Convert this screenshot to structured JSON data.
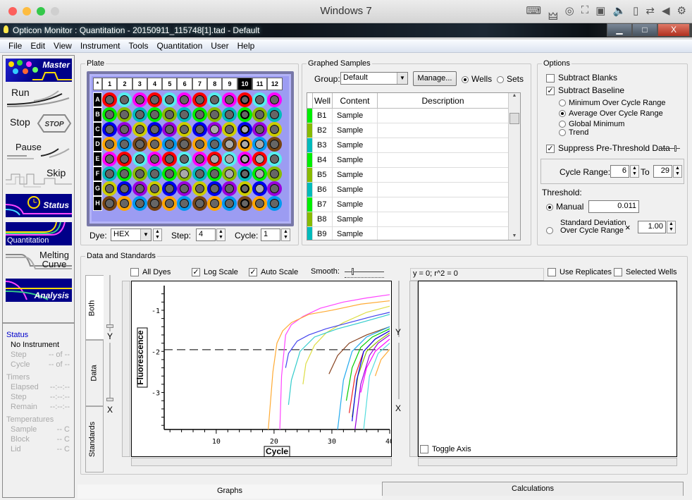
{
  "mac": {
    "title": "Windows 7",
    "traffic_colors": [
      "#fc605c",
      "#fdbc40",
      "#34c84a",
      "#cfcfcf"
    ],
    "status_icons": [
      "keyboard-icon",
      "usb-icon",
      "cd-icon",
      "network-icon",
      "floppy-icon",
      "audio-icon",
      "hdd-icon",
      "shared-folder-icon",
      "arrow-left-icon",
      "gear-icon"
    ],
    "status_glyphs": [
      "⌨",
      "🜲",
      "◎",
      "⛶",
      "▣",
      "🔈",
      "▯",
      "⇄",
      "◀",
      "⚙"
    ]
  },
  "window": {
    "title": "Opticon Monitor : Quantitation - 20150911_115748[1].tad - Default",
    "min": "▁",
    "max": "□",
    "close": "X"
  },
  "menu": [
    "File",
    "Edit",
    "View",
    "Instrument",
    "Tools",
    "Quantitation",
    "User",
    "Help"
  ],
  "nav": [
    {
      "label": "Master",
      "style": "dark"
    },
    {
      "label": "Run",
      "style": "light"
    },
    {
      "label": "Stop",
      "style": "light",
      "badge": "STOP"
    },
    {
      "label": "Pause",
      "style": "light"
    },
    {
      "label": "Skip",
      "style": "light"
    },
    {
      "label": "Status",
      "style": "dark"
    },
    {
      "label": "Quantitation",
      "style": "dark"
    },
    {
      "label": "Melting Curve",
      "style": "light"
    },
    {
      "label": "Analysis",
      "style": "dark"
    }
  ],
  "status": {
    "heading": "Status",
    "instrument": "No Instrument",
    "rows": [
      {
        "label": "Step",
        "value": "-- of --"
      },
      {
        "label": "Cycle",
        "value": "-- of --"
      }
    ],
    "timers_heading": "Timers",
    "timers": [
      {
        "label": "Elapsed",
        "value": "--:--:--"
      },
      {
        "label": "Step",
        "value": "--:--:--"
      },
      {
        "label": "Remain",
        "value": "--:--:--"
      }
    ],
    "temps_heading": "Temperatures",
    "temps": [
      {
        "label": "Sample",
        "value": "-- C"
      },
      {
        "label": "Block",
        "value": "-- C"
      },
      {
        "label": "Lid",
        "value": "-- C"
      }
    ]
  },
  "plate": {
    "label": "Plate",
    "corner": "*",
    "columns": [
      "1",
      "2",
      "3",
      "4",
      "5",
      "6",
      "7",
      "8",
      "9",
      "10",
      "11",
      "12"
    ],
    "selected_column": "10",
    "rows": [
      "A",
      "B",
      "C",
      "D",
      "E",
      "F",
      "G",
      "H"
    ],
    "ring_colors": {
      "A": [
        "#ff0000",
        "#55eeee",
        "#ff00ff",
        "#ff0000",
        "#55eeee",
        "#ff00ff",
        "#ff0000",
        "#55eeee",
        "#ff00ff",
        "#ff0000",
        "#55eeee",
        "#ff00ff"
      ],
      "B": [
        "#00ee00",
        "#88bb00",
        "#00bbbb",
        "#00ee00",
        "#88bb00",
        "#00bbbb",
        "#00ee00",
        "#88bb00",
        "#00bbbb",
        "#00ee00",
        "#88bb00",
        "#00bbbb"
      ],
      "C": [
        "#0000ee",
        "#9900dd",
        "#cccc00",
        "#0000ee",
        "#9900dd",
        "#cccc00",
        "#0000ee",
        "#9900dd",
        "#cccc00",
        "#0000ee",
        "#9900dd",
        "#cccc00"
      ],
      "D": [
        "#ffa500",
        "#0099ee",
        "#774411",
        "#ffa500",
        "#0099ee",
        "#774411",
        "#ffa500",
        "#0099ee",
        "#774411",
        "#ffa500",
        "#0099ee",
        "#774411"
      ],
      "E": [
        "#ff00ff",
        "#ff0000",
        "#55eeee",
        "#ff00ff",
        "#ff0000",
        "#55eeee",
        "#ff00ff",
        "#ff0000",
        "#55eeee",
        "#ff00ff",
        "#ff0000",
        "#55eeee"
      ],
      "F": [
        "#00bbbb",
        "#00ee00",
        "#88bb00",
        "#00bbbb",
        "#00ee00",
        "#88bb00",
        "#00bbbb",
        "#00ee00",
        "#88bb00",
        "#00bbbb",
        "#00ee00",
        "#88bb00"
      ],
      "G": [
        "#cccc00",
        "#0000ee",
        "#9900dd",
        "#cccc00",
        "#0000ee",
        "#9900dd",
        "#cccc00",
        "#0000ee",
        "#9900dd",
        "#cccc00",
        "#0000ee",
        "#9900dd"
      ],
      "H": [
        "#774411",
        "#ffa500",
        "#0099ee",
        "#774411",
        "#ffa500",
        "#0099ee",
        "#774411",
        "#ffa500",
        "#0099ee",
        "#774411",
        "#ffa500",
        "#0099ee"
      ]
    },
    "light_wells": [
      "C8",
      "C10",
      "D9",
      "D10",
      "D11",
      "E8",
      "E9",
      "E10",
      "E11",
      "F6",
      "F9",
      "F11",
      "G11"
    ],
    "dye_label": "Dye:",
    "dye_value": "HEX",
    "step_label": "Step:",
    "step_value": "4",
    "cycle_label": "Cycle:",
    "cycle_value": "1"
  },
  "graphed": {
    "label": "Graphed Samples",
    "group_label": "Group:",
    "group_value": "Default",
    "manage": "Manage...",
    "wells_radio": "Wells",
    "sets_radio": "Sets",
    "columns": [
      "Well",
      "Content",
      "Description"
    ],
    "rows": [
      {
        "well": "B1",
        "content": "Sample",
        "description": "",
        "color": "#00ee00"
      },
      {
        "well": "B2",
        "content": "Sample",
        "description": "",
        "color": "#88bb00"
      },
      {
        "well": "B3",
        "content": "Sample",
        "description": "",
        "color": "#00bbbb"
      },
      {
        "well": "B4",
        "content": "Sample",
        "description": "",
        "color": "#00ee00"
      },
      {
        "well": "B5",
        "content": "Sample",
        "description": "",
        "color": "#88bb00"
      },
      {
        "well": "B6",
        "content": "Sample",
        "description": "",
        "color": "#00bbbb"
      },
      {
        "well": "B7",
        "content": "Sample",
        "description": "",
        "color": "#00ee00"
      },
      {
        "well": "B8",
        "content": "Sample",
        "description": "",
        "color": "#88bb00"
      },
      {
        "well": "B9",
        "content": "Sample",
        "description": "",
        "color": "#00bbbb"
      }
    ]
  },
  "options": {
    "label": "Options",
    "subtract_blanks": "Subtract Blanks",
    "subtract_blanks_checked": false,
    "subtract_baseline": "Subtract Baseline",
    "subtract_baseline_checked": true,
    "baseline_modes": [
      {
        "label": "Minimum Over Cycle Range",
        "selected": false
      },
      {
        "label": "Average Over Cycle Range",
        "selected": true
      },
      {
        "label": "Global Minimum",
        "selected": false
      },
      {
        "label": "Trend",
        "selected": false
      }
    ],
    "suppress": "Suppress Pre-Threshold Data",
    "suppress_checked": true,
    "cycle_range_label": "Cycle Range:",
    "cycle_from": "6",
    "to_label": "To",
    "cycle_to": "29",
    "threshold_label": "Threshold:",
    "manual_label": "Manual",
    "manual_value": "0.011",
    "sd_label_1": "Standard Deviation",
    "sd_label_2": "Over Cycle Range",
    "times": "×",
    "sd_value": "1.00"
  },
  "data_standards": {
    "label": "Data and Standards",
    "all_dyes": "All Dyes",
    "log_scale": "Log Scale",
    "auto_scale": "Auto Scale",
    "smooth": "Smooth:",
    "tabs": [
      "Both",
      "Data",
      "Standards"
    ],
    "y_slider": "Y",
    "x_slider": "X",
    "equation": "y = 0;  r^2 = 0",
    "use_replicates": "Use Replicates",
    "selected_wells": "Selected Wells",
    "toggle_axis": "Toggle Axis"
  },
  "chart_data": {
    "type": "line",
    "xlabel": "Cycle",
    "ylabel": "Fluorescence",
    "xlim": [
      1,
      40
    ],
    "ylim": [
      -3.9,
      -0.4
    ],
    "xticks": [
      10,
      20,
      30,
      40
    ],
    "yticks": [
      -1,
      -2,
      -3
    ],
    "threshold": -1.96,
    "series": [
      {
        "color": "#ff44ff",
        "x": [
          21,
          21.3,
          22,
          23,
          25,
          28,
          32,
          36,
          40
        ],
        "y": [
          -3.9,
          -2.6,
          -1.6,
          -1.35,
          -1.15,
          -0.95,
          -0.8,
          -0.7,
          -0.62
        ]
      },
      {
        "color": "#ffaa33",
        "x": [
          19,
          19.8,
          20.5,
          21.5,
          23,
          26,
          30,
          35,
          40
        ],
        "y": [
          -3.9,
          -2.5,
          -1.8,
          -1.5,
          -1.3,
          -1.1,
          -1.0,
          -0.85,
          -0.77
        ]
      },
      {
        "color": "#dddd44",
        "x": [
          25,
          25.5,
          27,
          29,
          32,
          36,
          40
        ],
        "y": [
          -2.8,
          -2.3,
          -1.85,
          -1.55,
          -1.3,
          -1.05,
          -0.9
        ]
      },
      {
        "color": "#4444ee",
        "x": [
          22,
          22.5,
          24,
          26,
          29,
          33,
          37,
          40
        ],
        "y": [
          -2.4,
          -2.05,
          -1.75,
          -1.6,
          -1.45,
          -1.3,
          -1.15,
          -1.05
        ]
      },
      {
        "color": "#33cccc",
        "x": [
          22.5,
          23,
          24.5,
          27,
          31,
          35,
          40
        ],
        "y": [
          -3.3,
          -2.7,
          -2.0,
          -1.65,
          -1.45,
          -1.3,
          -1.1
        ]
      },
      {
        "color": "#884422",
        "x": [
          29.5,
          31,
          33,
          36,
          40
        ],
        "y": [
          -2.55,
          -2.1,
          -1.8,
          -1.6,
          -1.4
        ]
      },
      {
        "color": "#22aaee",
        "x": [
          31,
          32,
          33.5,
          36,
          40
        ],
        "y": [
          -3.9,
          -2.7,
          -2.0,
          -1.65,
          -1.4
        ]
      },
      {
        "color": "#00cc00",
        "x": [
          32.5,
          33.5,
          35,
          37,
          40
        ],
        "y": [
          -3.2,
          -2.4,
          -1.9,
          -1.65,
          -1.45
        ]
      },
      {
        "color": "#ee2222",
        "x": [
          33,
          34,
          35.5,
          37.5,
          40
        ],
        "y": [
          -3.5,
          -2.6,
          -2.0,
          -1.7,
          -1.5
        ]
      },
      {
        "color": "#9900dd",
        "x": [
          34,
          35,
          36.5,
          38,
          40
        ],
        "y": [
          -3.9,
          -2.8,
          -2.1,
          -1.8,
          -1.6
        ]
      },
      {
        "color": "#88bb00",
        "x": [
          33.5,
          34.5,
          36,
          38,
          40
        ],
        "y": [
          -3.6,
          -2.6,
          -2.0,
          -1.75,
          -1.55
        ]
      },
      {
        "color": "#0000ee",
        "x": [
          33.5,
          34.3,
          35.5,
          37.5,
          40
        ],
        "y": [
          -3.7,
          -2.7,
          -2.0,
          -1.7,
          -1.5
        ]
      },
      {
        "color": "#ff00ff",
        "x": [
          35,
          36,
          37.5,
          40
        ],
        "y": [
          -3.0,
          -2.4,
          -2.0,
          -1.7
        ]
      },
      {
        "color": "#ffaa33",
        "x": [
          37.5,
          38.5,
          40
        ],
        "y": [
          -2.6,
          -2.2,
          -1.95
        ]
      },
      {
        "color": "#55dddd",
        "x": [
          35.5,
          36.5,
          38,
          40
        ],
        "y": [
          -3.9,
          -2.6,
          -2.05,
          -1.8
        ]
      }
    ]
  },
  "bottom_tabs": [
    "Graphs",
    "Calculations"
  ]
}
